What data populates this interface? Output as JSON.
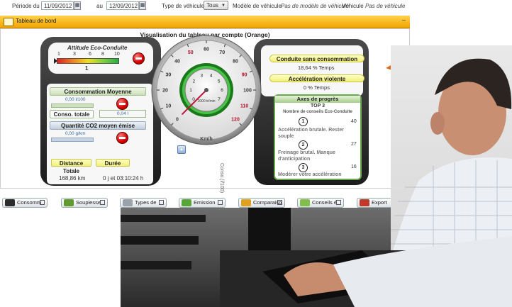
{
  "filters": {
    "period_from_label": "Période du",
    "date_from": "11/09/2012",
    "to_label": "au",
    "date_to": "12/09/2012",
    "vehicle_type_label": "Type de véhicule",
    "vehicle_type_value": "Tous",
    "vehicle_model_label": "Modèle de véhicule",
    "vehicle_model_value": "Pas de modèle de véhicule",
    "vehicle_label": "Véhicule",
    "vehicle_value": "Pas de véhicule"
  },
  "panel": {
    "title": "Tableau de bord",
    "heading": "Visualisation du tableau par compte (Orange)"
  },
  "attitude": {
    "title": "Attitude Eco-Conduite",
    "scale": [
      "1",
      "3",
      "6",
      "8",
      "10"
    ],
    "value": "1"
  },
  "consumption": {
    "title": "Consommation Moyenne",
    "per100": "0,00 l/100",
    "total_label": "Conso. totale",
    "total_value": "0,04 l"
  },
  "co2": {
    "title": "Quantité CO2 moyen émise",
    "value": "0,00 g/km"
  },
  "distance": {
    "label": "Distance Totale",
    "value": "168,86 km"
  },
  "duration": {
    "label": "Durée",
    "value": "0 j et 03:10:24 h"
  },
  "gauge": {
    "ticks": [
      "0",
      "10",
      "20",
      "30",
      "40",
      "50",
      "60",
      "70",
      "80",
      "90",
      "100",
      "110",
      "120"
    ],
    "inner_ticks": [
      "0",
      "1",
      "2",
      "3",
      "4",
      "5",
      "6",
      "7"
    ],
    "rpm_label": "1000 tr/min",
    "unit": "Km/h",
    "speed_value": 0,
    "vertical_label": "Conso.(l/100)"
  },
  "stats": {
    "no_consumption_label": "Conduite sans consommation",
    "no_consumption_value": "18,64 % Temps",
    "violent_accel_label": "Accélération violente",
    "violent_accel_value": "0 % Temps"
  },
  "progress": {
    "title": "Axes de progrès",
    "subtitle": "TOP 3",
    "caption": "Nombre de conseils Eco-Conduite",
    "items": [
      {
        "rank": "1",
        "count": "40",
        "text_line1": "Accélération brutale. Rester",
        "text_line2": "souple"
      },
      {
        "rank": "2",
        "count": "27",
        "text_line1": "Freinage brutal. Manque",
        "text_line2": "d'anticipation"
      },
      {
        "rank": "3",
        "count": "16",
        "text_line1": "Modérer votre accélération",
        "text_line2": ""
      }
    ]
  },
  "tabs": [
    {
      "label": "Consomm",
      "color": "#2b2b2b"
    },
    {
      "label": "Souplesse",
      "color": "#5e9a2e"
    },
    {
      "label": "Types de",
      "color": "#9aa3ad"
    },
    {
      "label": "Emission",
      "color": "#56a63a"
    },
    {
      "label": "Comparaiso",
      "color": "#e0a020"
    },
    {
      "label": "Conseils é",
      "color": "#7fbf4a"
    },
    {
      "label": "Export",
      "color": "#c0392b"
    }
  ],
  "colors": {
    "accent": "#f0a400",
    "arrow": "#e06a10"
  }
}
